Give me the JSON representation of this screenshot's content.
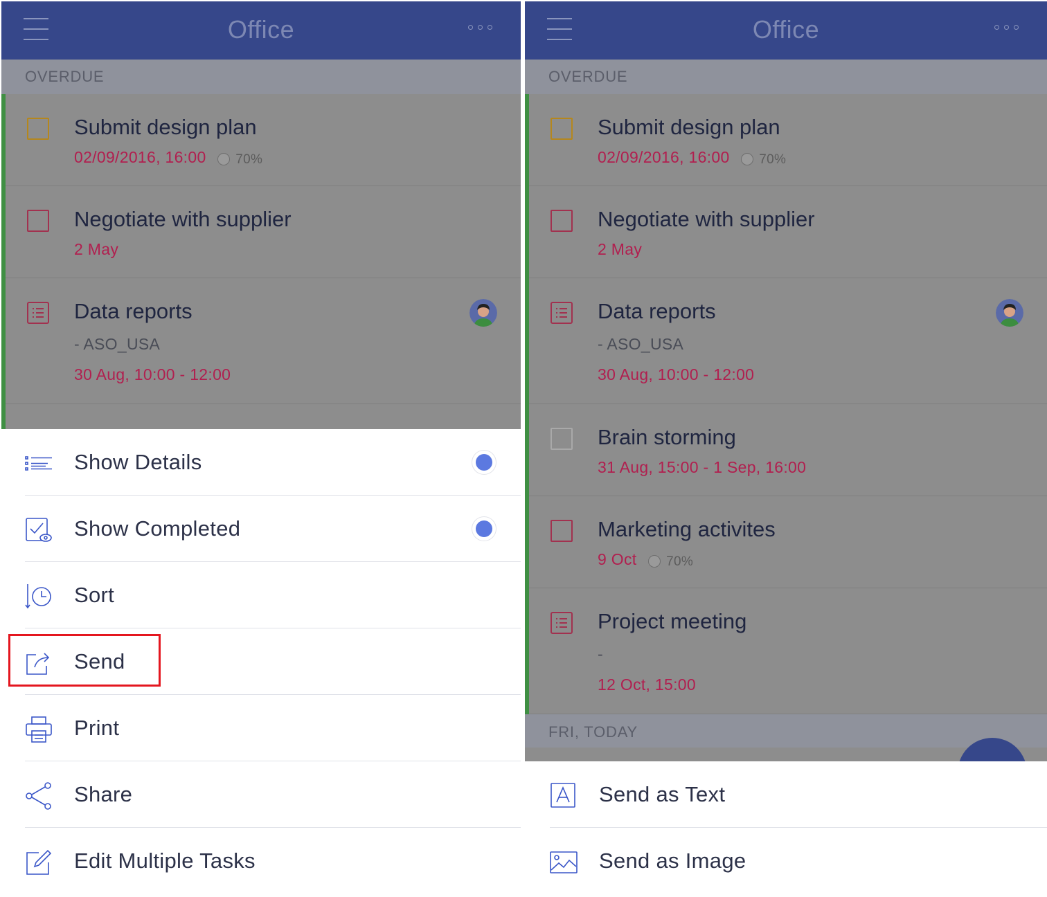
{
  "colors": {
    "appbar": "#36478a",
    "overdue_red": "#b11f4f",
    "accent_green": "#3f8f43",
    "toggle_blue": "#5c79e0",
    "highlight_red": "#e4161f"
  },
  "left": {
    "appbar": {
      "title": "Office",
      "menu_icon": "hamburger-icon",
      "more_icon": "more-dots-icon"
    },
    "section": "OVERDUE",
    "tasks": [
      {
        "title": "Submit  design plan",
        "meta": "02/09/2016, 16:00",
        "progress": "70%",
        "progress_value": 0.7,
        "icon": "checkbox-icon"
      },
      {
        "title": "Negotiate with supplier",
        "meta": "2 May",
        "icon": "checkbox-icon"
      },
      {
        "title": "Data reports",
        "sub": "- ASO_USA",
        "meta": "30 Aug, 10:00 - 12:00",
        "icon": "note-icon",
        "avatar": "avatar-icon"
      }
    ],
    "menu": [
      {
        "label": "Show Details",
        "icon": "list-details-icon",
        "toggle": true
      },
      {
        "label": "Show Completed",
        "icon": "completed-eye-icon",
        "toggle": true
      },
      {
        "label": "Sort",
        "icon": "sort-clock-icon"
      },
      {
        "label": "Send",
        "icon": "send-icon",
        "highlighted": true
      },
      {
        "label": "Print",
        "icon": "printer-icon"
      },
      {
        "label": "Share",
        "icon": "share-icon"
      },
      {
        "label": "Edit Multiple Tasks",
        "icon": "edit-icon"
      }
    ]
  },
  "right": {
    "appbar": {
      "title": "Office",
      "menu_icon": "hamburger-icon",
      "more_icon": "more-dots-icon"
    },
    "section": "OVERDUE",
    "tasks": [
      {
        "title": "Submit  design plan",
        "meta": "02/09/2016, 16:00",
        "progress": "70%",
        "progress_value": 0.7,
        "icon": "checkbox-icon"
      },
      {
        "title": "Negotiate with supplier",
        "meta": "2 May",
        "icon": "checkbox-icon"
      },
      {
        "title": "Data reports",
        "sub": "- ASO_USA",
        "meta": "30 Aug, 10:00 - 12:00",
        "icon": "note-icon",
        "avatar": "avatar-icon"
      },
      {
        "title": "Brain storming",
        "meta": "31 Aug, 15:00 - 1 Sep, 16:00",
        "icon": "checkbox-icon"
      },
      {
        "title": "Marketing activites",
        "meta": "9 Oct",
        "progress": "70%",
        "progress_value": 0.7,
        "icon": "checkbox-icon"
      },
      {
        "title": "Project meeting",
        "sub": "-",
        "meta": "12 Oct, 15:00",
        "icon": "note-icon"
      }
    ],
    "section2": "FRI, TODAY",
    "send_menu": [
      {
        "label": "Send as Text",
        "icon": "text-icon"
      },
      {
        "label": "Send as Image",
        "icon": "image-icon"
      }
    ]
  }
}
